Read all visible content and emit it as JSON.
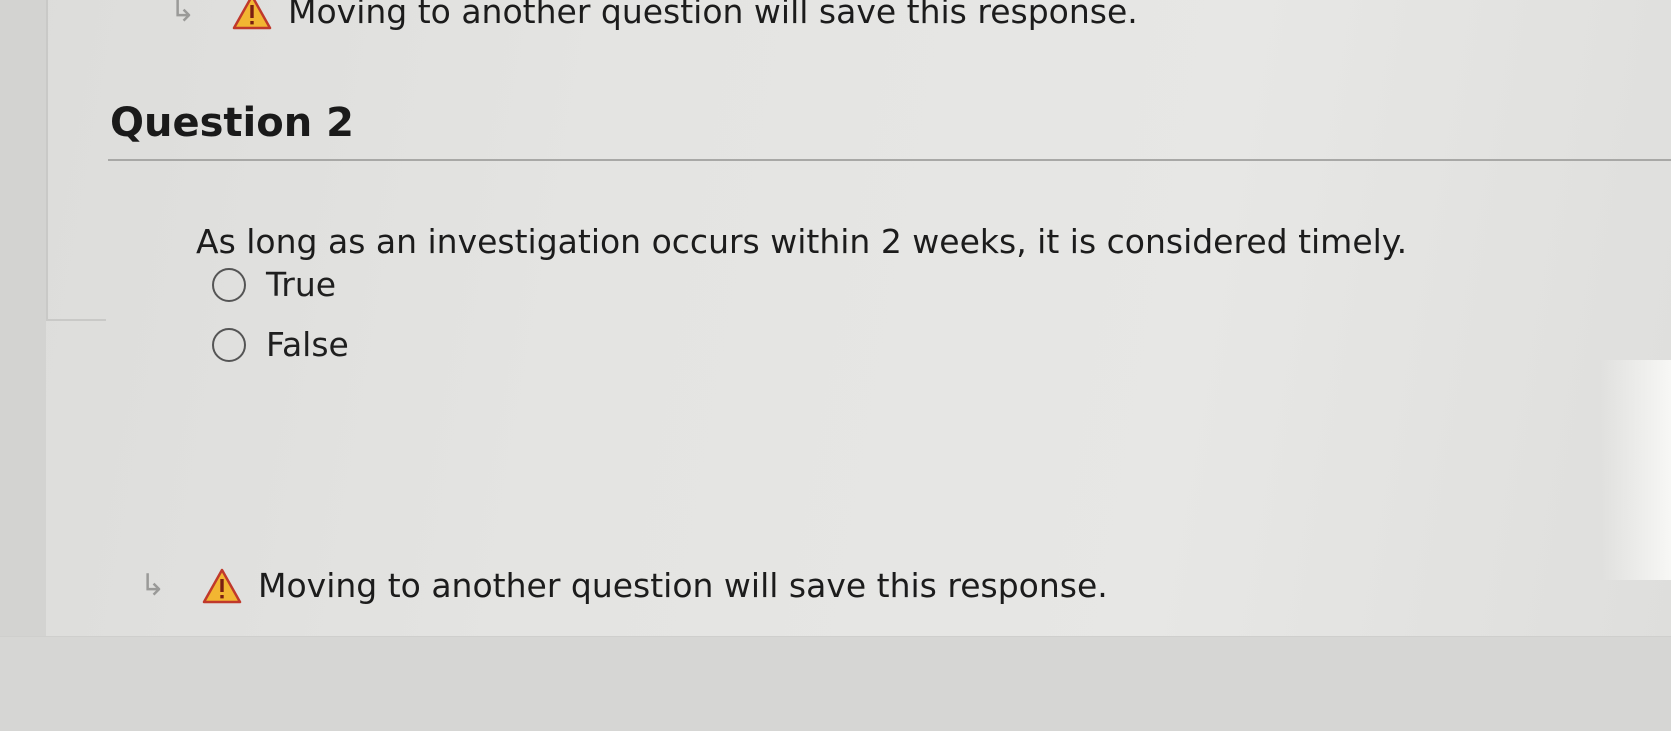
{
  "save_notice_top": {
    "icon": "warning-icon",
    "text": "Moving to another question will save this response."
  },
  "question": {
    "title": "Question 2",
    "text": "As long as an investigation occurs within 2 weeks, it is considered timely.",
    "options": [
      {
        "label": "True",
        "selected": false
      },
      {
        "label": "False",
        "selected": false
      }
    ]
  },
  "save_notice_bottom": {
    "icon": "warning-icon",
    "arrow_icon": "return-arrow-icon",
    "text": "Moving to another question will save this response."
  },
  "colors": {
    "warning_fill": "#f2b632",
    "warning_border": "#c0392b"
  }
}
